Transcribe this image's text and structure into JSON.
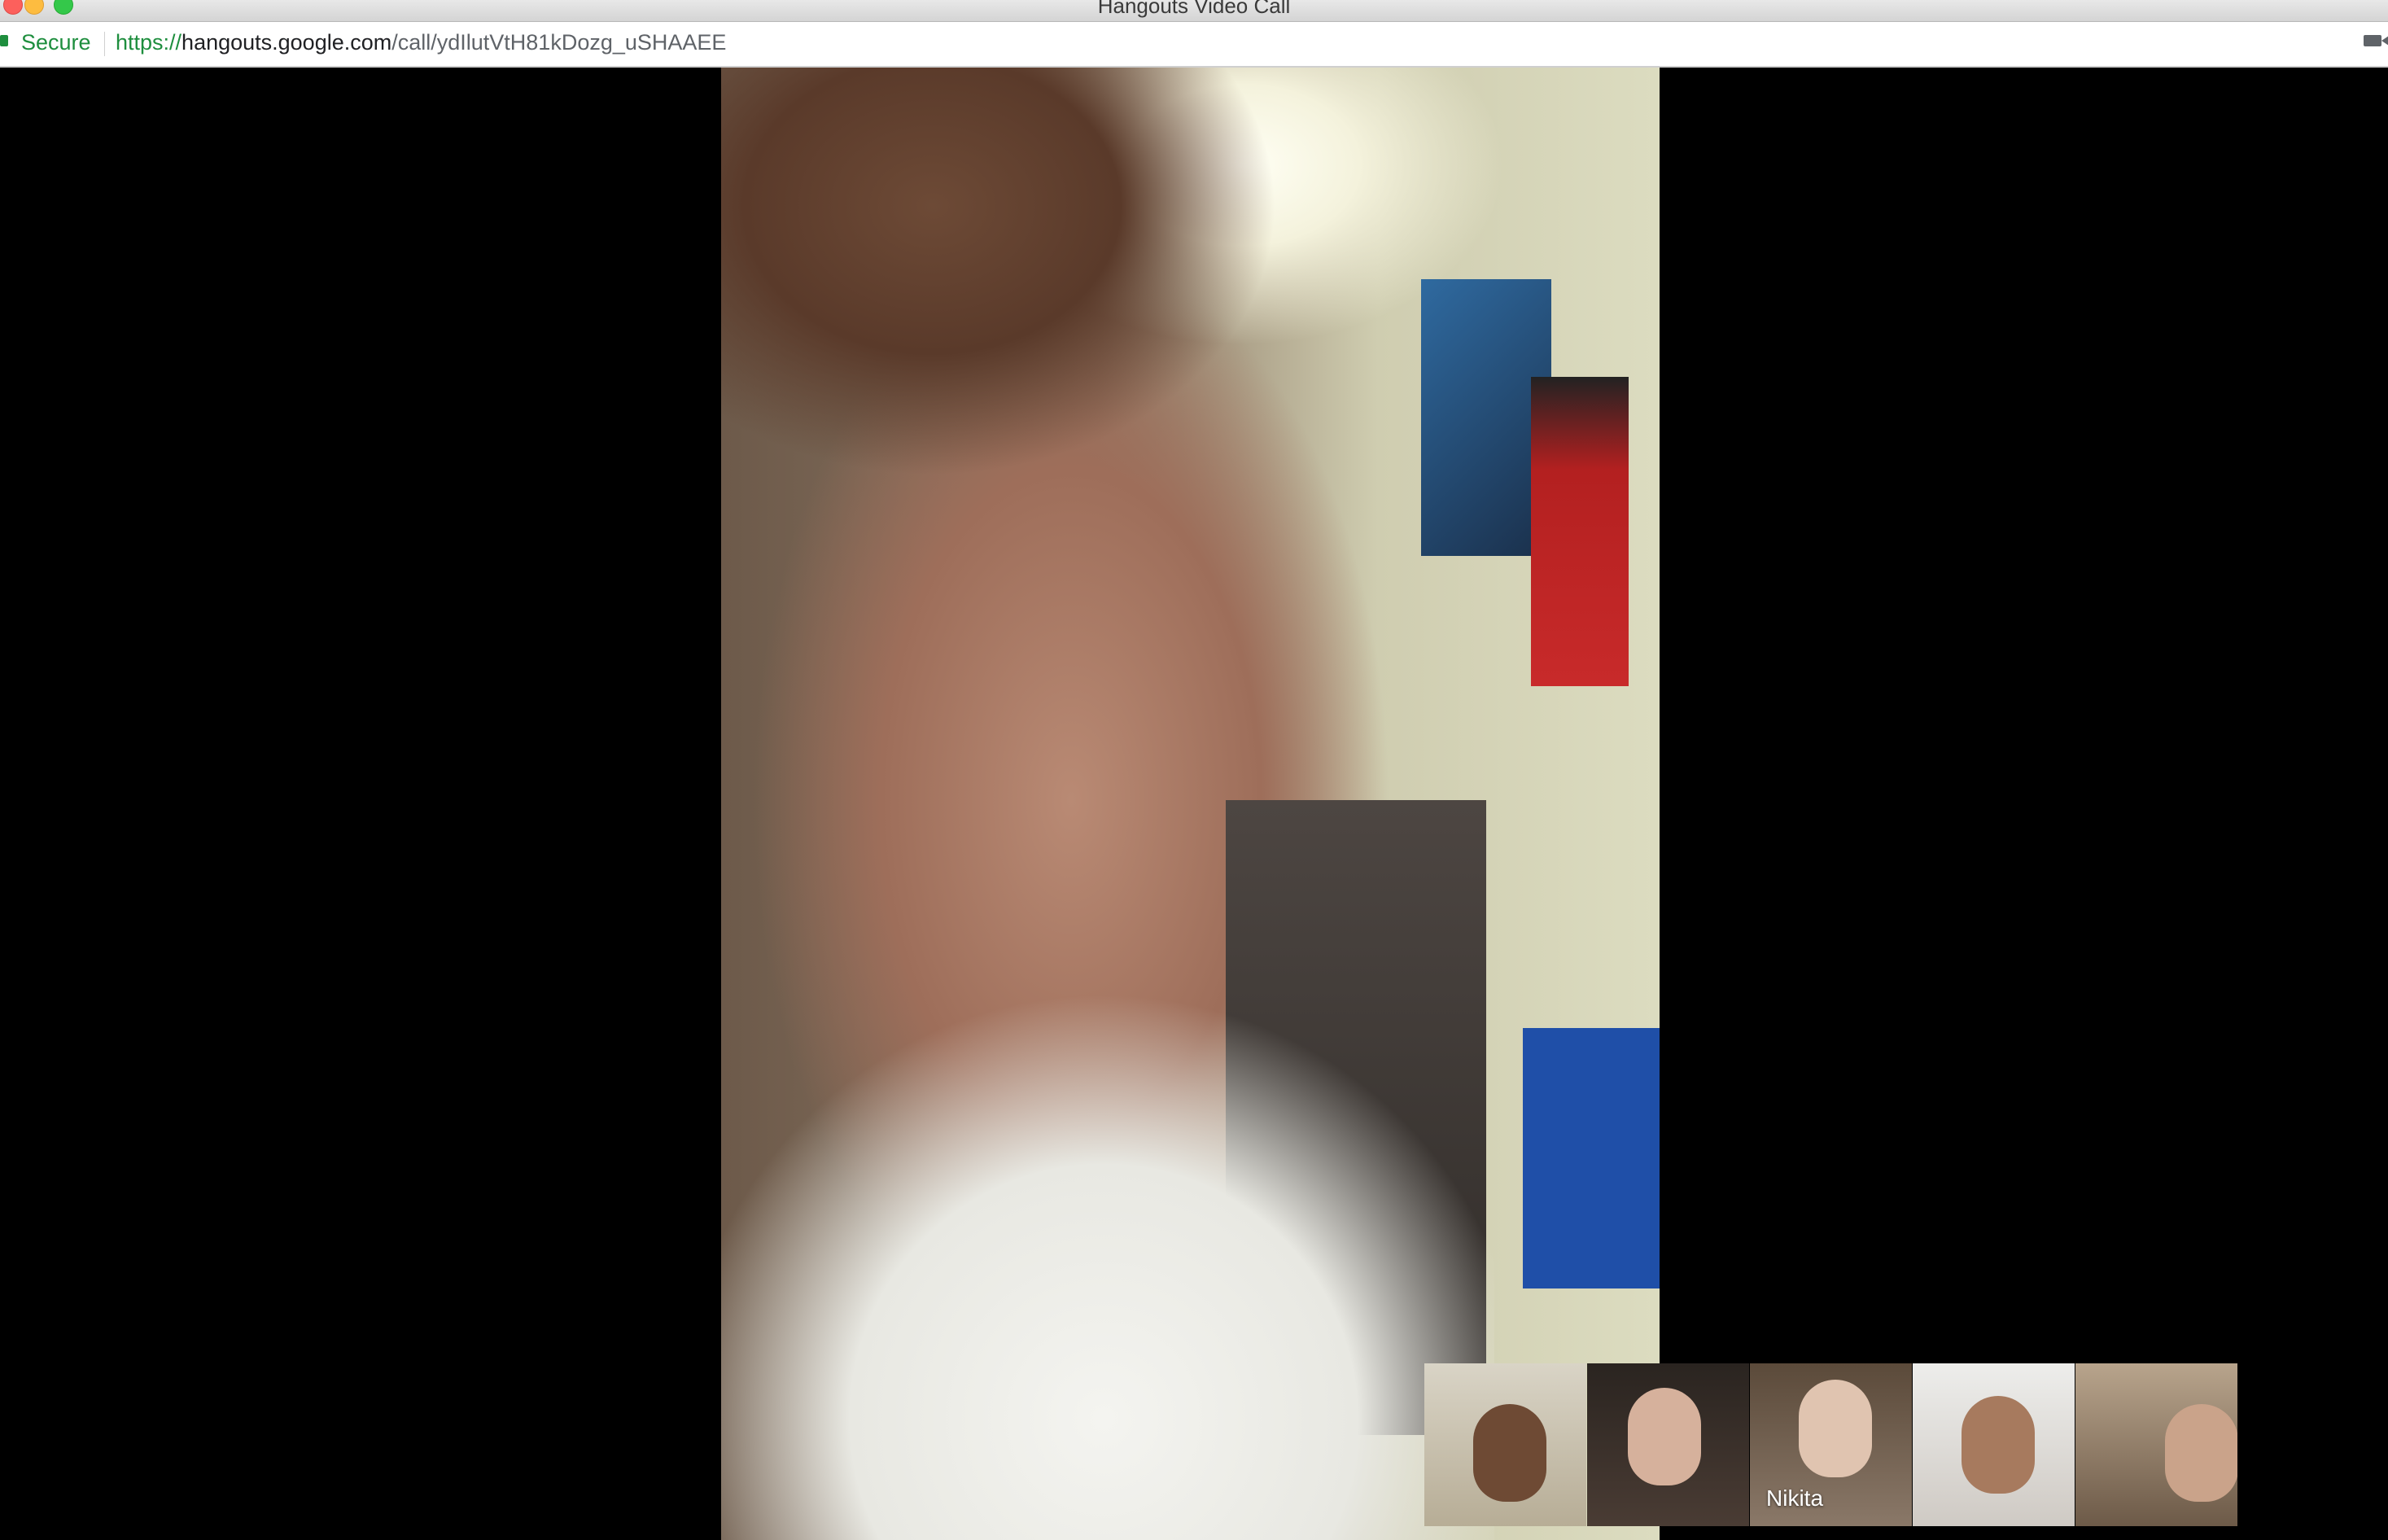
{
  "window": {
    "title": "Hangouts Video Call"
  },
  "address_bar": {
    "security_label": "Secure",
    "url_scheme": "https://",
    "url_host": "hangouts.google.com",
    "url_path": "/call/ydIlutVtH81kDozg_uSHAAEE"
  },
  "main_video": {
    "description_icon": "main-participant-video"
  },
  "participants": [
    {
      "label": ""
    },
    {
      "label": ""
    },
    {
      "label": "Nikita"
    },
    {
      "label": ""
    },
    {
      "label": ""
    }
  ],
  "icons": {
    "lock": "lock-icon",
    "camera": "camera-icon"
  },
  "colors": {
    "secure_green": "#1e8e3e",
    "stage_background": "#000000"
  }
}
